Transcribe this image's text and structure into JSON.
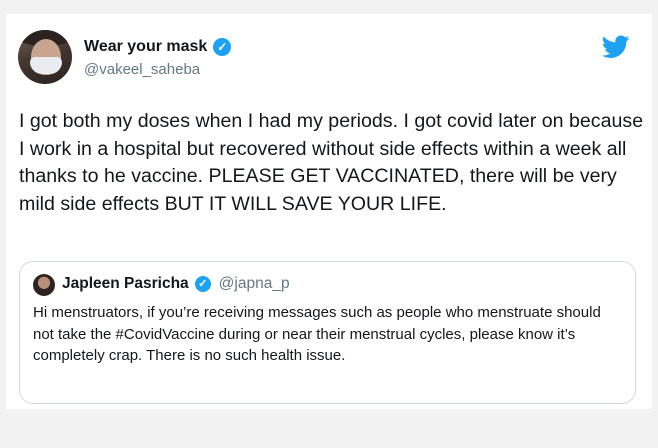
{
  "tweet": {
    "author": {
      "display_name": "Wear your mask",
      "handle": "@vakeel_saheba",
      "verified_icon": "verified-check-icon"
    },
    "brand_icon": "twitter-bird-icon",
    "text": "I got both my doses when I had my periods. I got covid later on because I work in a hospital but recovered without side effects within a week all thanks to he vaccine. PLEASE GET VACCINATED, there will be very mild side effects BUT IT WILL SAVE YOUR LIFE.",
    "quoted": {
      "author": {
        "display_name": "Japleen Pasricha",
        "handle": "@japna_p",
        "verified_icon": "verified-check-icon"
      },
      "text": "Hi menstruators, if you’re receiving messages such as people who menstruate should not take the #CovidVaccine during or near their menstrual cycles, please know it’s completely crap. There is no such health issue."
    }
  },
  "colors": {
    "text": "#14171a",
    "secondary": "#657786",
    "twitter_blue": "#1da1f2",
    "border": "#cfd9de"
  }
}
